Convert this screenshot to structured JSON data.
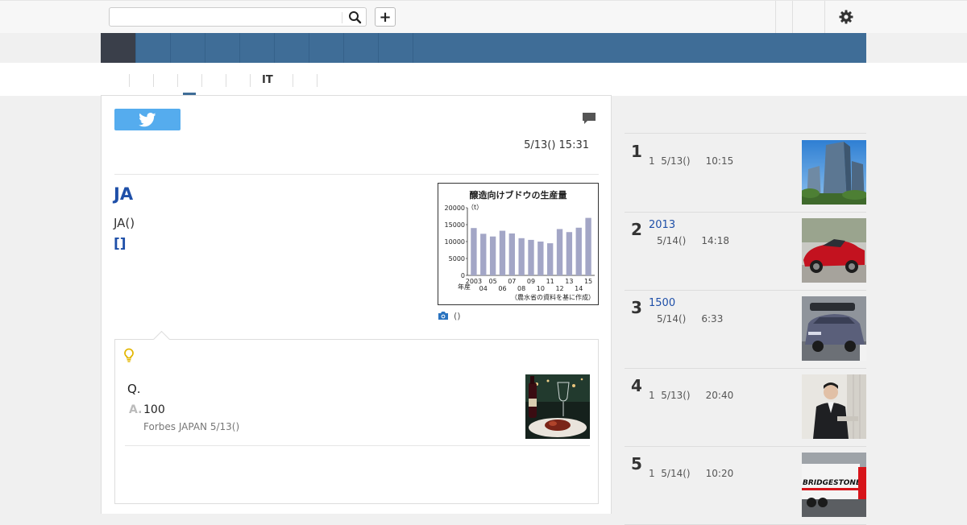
{
  "search": {
    "placeholder": "",
    "value": ""
  },
  "toolbar": {
    "add_label": "+"
  },
  "nav": {
    "items": [
      "",
      "",
      "",
      "",
      "",
      "",
      "",
      "",
      ""
    ]
  },
  "subnav": {
    "tabs": [
      "",
      "",
      "",
      "",
      "",
      "IT",
      "",
      ""
    ]
  },
  "article": {
    "timestamp": "5/13() 15:31",
    "headline": "JA",
    "lead": "JA()",
    "more_link": "[]",
    "figure_caption": "()"
  },
  "figure_chart": {
    "chart_data": {
      "type": "bar",
      "title": "醸造向けブドウの生産量",
      "ylabel": "（t）",
      "xlabel": "年産",
      "ylim": [
        0,
        20000
      ],
      "yticks": [
        "20000",
        "15000",
        "10000",
        "5000",
        "0"
      ],
      "categories": [
        "2003",
        "04",
        "05",
        "06",
        "07",
        "08",
        "09",
        "10",
        "11",
        "12",
        "13",
        "14",
        "15"
      ],
      "values": [
        14000,
        12300,
        11500,
        13200,
        12400,
        11000,
        10500,
        10000,
        9500,
        13700,
        12800,
        14100,
        17000
      ],
      "annotation": "（農水省の資料を基に作成）",
      "grid": false,
      "color": "#a3a6c6"
    }
  },
  "hint": {
    "question": "Q.",
    "answer_letter": "A.",
    "answer": "100",
    "source": "Forbes JAPAN 5/13()"
  },
  "ranking": [
    {
      "rank": "1",
      "title": "",
      "meta": "1  5/13()     10:15"
    },
    {
      "rank": "2",
      "title": "2013",
      "meta": "5/14()     14:18"
    },
    {
      "rank": "3",
      "title": "1500",
      "meta": "5/14()     6:33"
    },
    {
      "rank": "4",
      "title": "",
      "meta": "1  5/13()     20:40"
    },
    {
      "rank": "5",
      "title": "",
      "meta": "1  5/14()     10:20"
    }
  ],
  "thumb_texts": {
    "bridgestone": "BRIDGESTONE"
  },
  "colors": {
    "nav": "#3f6d97",
    "nav_active": "#3a3f4a",
    "link": "#1e4fa8",
    "twitter": "#55acee"
  }
}
